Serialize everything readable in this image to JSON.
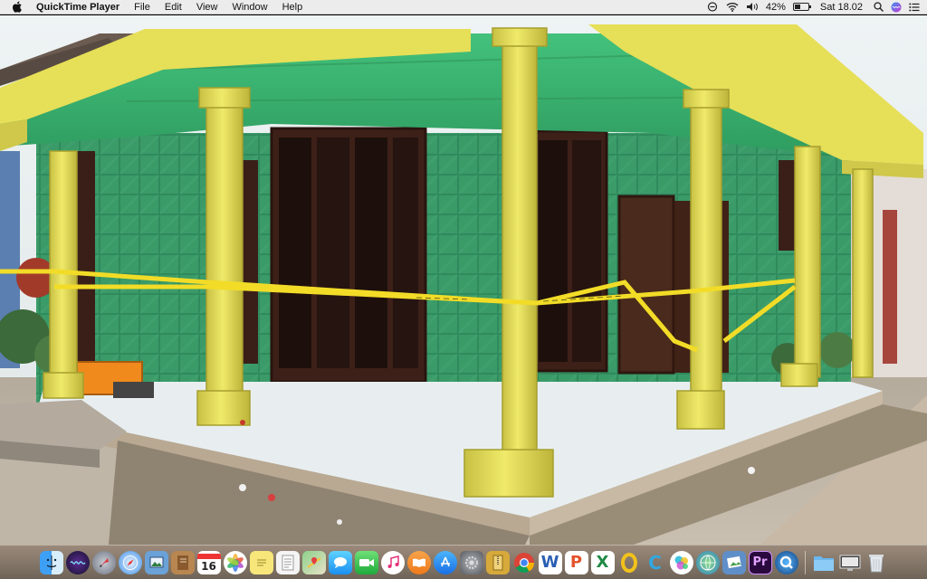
{
  "menubar": {
    "app_name": "QuickTime Player",
    "menus": [
      "File",
      "Edit",
      "View",
      "Window",
      "Help"
    ],
    "battery_percent": "42%",
    "battery_level": 0.42,
    "clock": "Sat 18.02"
  },
  "dock": {
    "calendar_day": "16",
    "apps": [
      "finder",
      "siri",
      "launchpad",
      "safari",
      "preview",
      "notes-book",
      "calendar",
      "photos",
      "stickies",
      "text-doc",
      "maps",
      "messages",
      "facetime",
      "music",
      "books",
      "app-store",
      "system-preferences",
      "archive",
      "chrome",
      "word",
      "wps",
      "excel",
      "quicktime-o",
      "c-app",
      "game-center",
      "network-globe",
      "photo-preview",
      "premiere",
      "quicktime",
      "folder",
      "screen",
      "trash"
    ],
    "labels": {
      "word": "W",
      "wps": "P",
      "excel": "X",
      "c_app": "C",
      "premiere": "Pr"
    }
  },
  "colors": {
    "menubar_bg": "#ececec",
    "pillar_yellow": "#e9e35a",
    "tile_green": "#2f8a5c",
    "ceiling_green": "#38b56f",
    "police_tape": "#f2dc27",
    "floor_white": "#e8eef0",
    "dock_bg": "#8a7c6e"
  }
}
